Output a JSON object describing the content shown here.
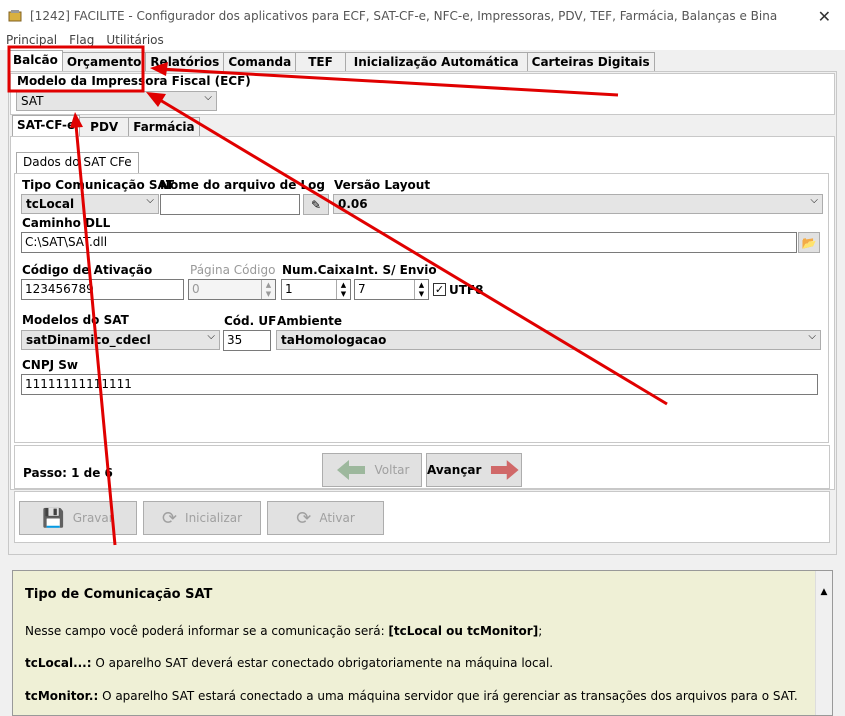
{
  "window": {
    "title": "[1242] FACILITE - Configurador dos aplicativos para ECF, SAT-CF-e, NFC-e, Impressoras, PDV, TEF, Farmácia, Balanças e Bina",
    "close": "✕"
  },
  "menu": [
    "Principal",
    "Flag",
    "Utilitários"
  ],
  "main_tabs": [
    "Balcão",
    "Orçamento",
    "Relatórios",
    "Comanda",
    "TEF",
    "Inicialização Automática",
    "Carteiras Digitais"
  ],
  "printer": {
    "label": "Modelo da Impressora Fiscal (ECF)",
    "value": "SAT"
  },
  "sub_tabs": [
    "SAT-CF-e",
    "PDV",
    "Farmácia"
  ],
  "group_title": "Dados do SAT CFe",
  "fields": {
    "tipo_label": "Tipo Comunicação SAT",
    "tipo_value": "tcLocal",
    "arquivo_label": "Nome do arquivo de Log",
    "arquivo_value": "",
    "versao_label": "Versão Layout",
    "versao_value": "0.06",
    "dll_label": "Caminho DLL",
    "dll_value": "C:\\SAT\\SAT.dll",
    "ativacao_label": "Código de Ativação",
    "ativacao_value": "123456789",
    "pagina_label": "Página Código",
    "pagina_value": "0",
    "caixa_label": "Num.Caixa",
    "caixa_value": "1",
    "envio_label": "Int. S/ Envio",
    "envio_value": "7",
    "utf8_label": "UTF8",
    "modelos_label": "Modelos do SAT",
    "modelos_value": "satDinamico_cdecl",
    "uf_label": "Cód. UF",
    "uf_value": "35",
    "ambiente_label": "Ambiente",
    "ambiente_value": "taHomologacao",
    "cnpj_label": "CNPJ Sw",
    "cnpj_value": "11111111111111"
  },
  "wizard": {
    "step": "Passo: 1 de 6",
    "back": "Voltar",
    "next": "Avançar"
  },
  "actions": {
    "save": "Gravar",
    "init": "Inicializar",
    "activate": "Ativar"
  },
  "help": {
    "title": "Tipo de Comunicação SAT",
    "line1_a": "Nesse campo você poderá informar se a comunicação será: ",
    "line1_b": "[tcLocal ou tcMonitor]",
    "line1_c": ";",
    "line2_a": "tcLocal...:",
    "line2_b": " O aparelho SAT deverá estar conectado obrigatoriamente na máquina local.",
    "line3_a": "tcMonitor.:",
    "line3_b": " O aparelho SAT estará conectado a uma máquina servidor que irá gerenciar as transações dos arquivos para o SAT."
  },
  "colors": {
    "annotation": "#e00000",
    "help_bg": "#eff0d6"
  }
}
